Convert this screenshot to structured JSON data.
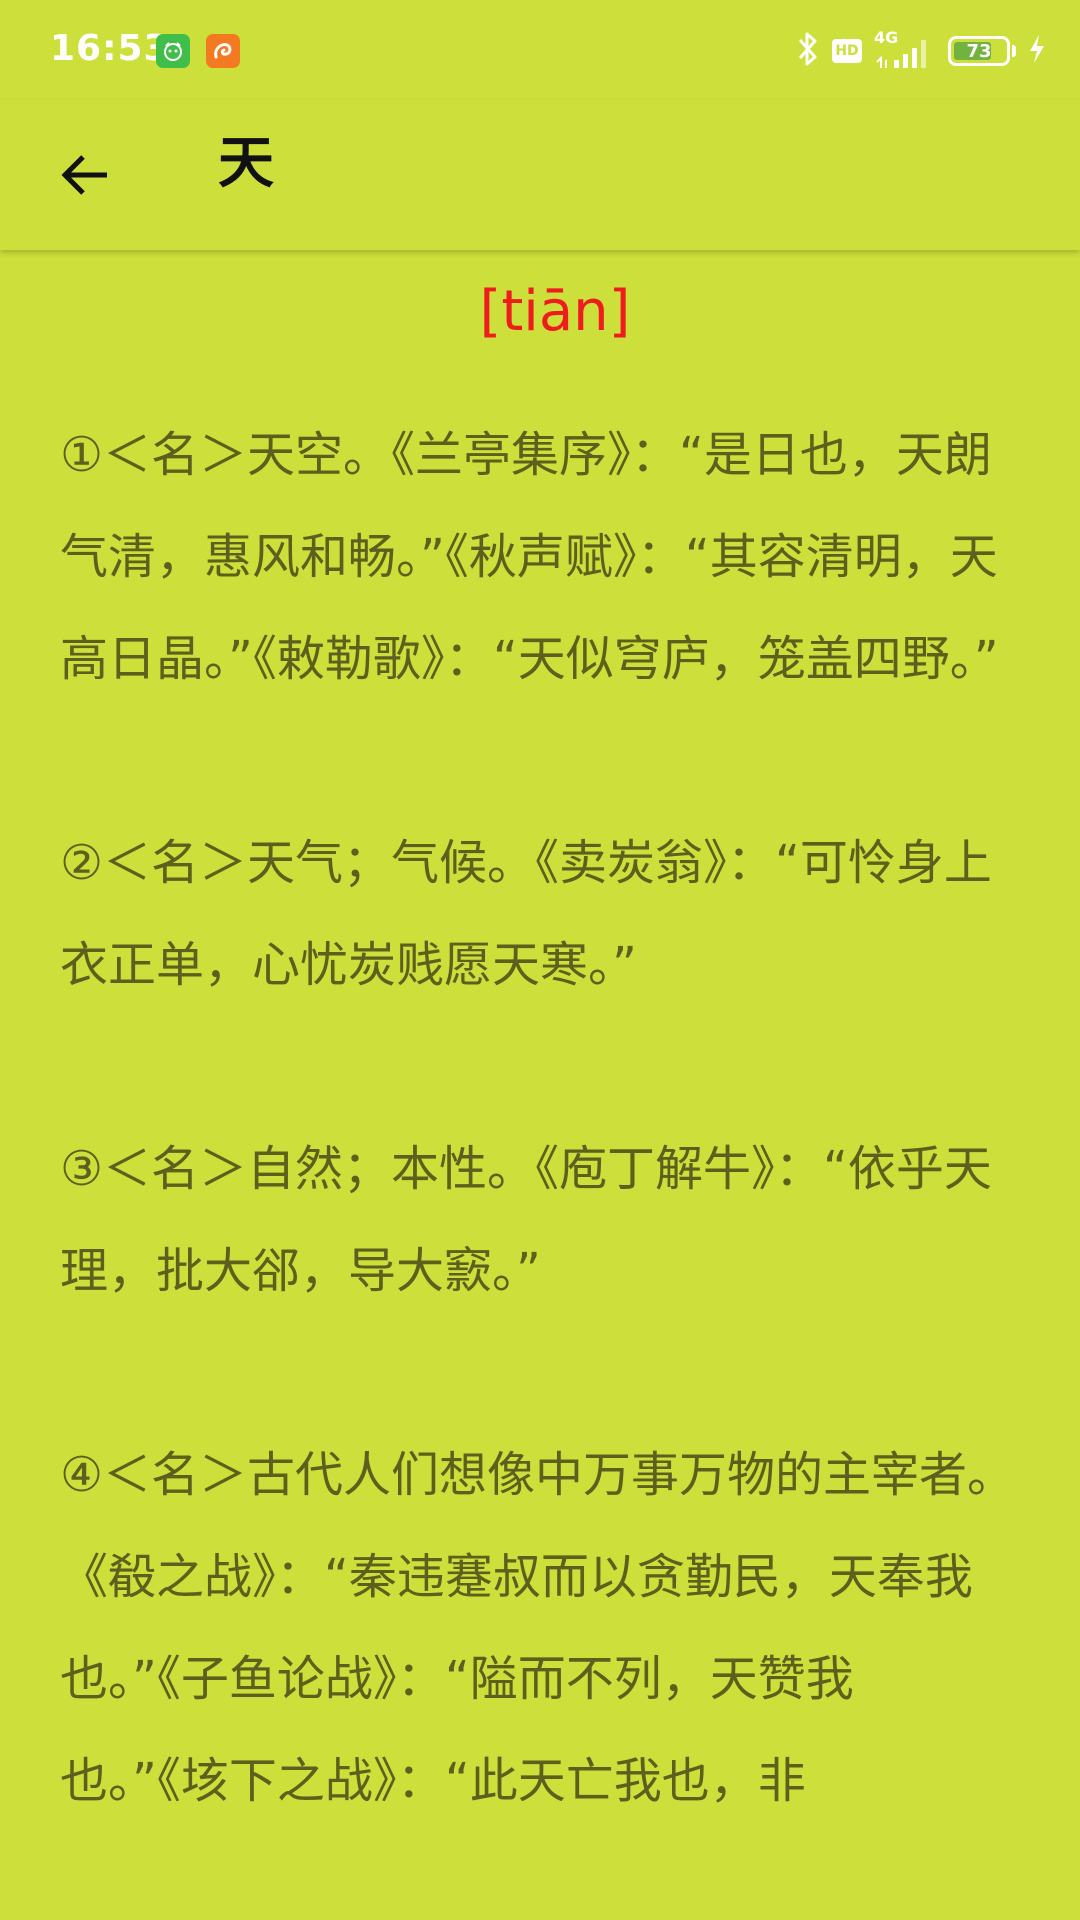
{
  "status_bar": {
    "time": "16:53",
    "network": "4G",
    "hd": "HD",
    "battery_level": "73",
    "battery_fraction": 0.73
  },
  "app_bar": {
    "title": "天"
  },
  "entry": {
    "pinyin": "[tiān]",
    "definitions": [
      "①＜名＞天空。《兰亭集序》：“是日也，天朗气清，惠风和畅。”《秋声赋》：“其容清明，天高日晶。”《敕勒歌》：“天似穹庐，笼盖四野。”",
      "②＜名＞天气；气候。《卖炭翁》：“可怜身上衣正单，心忧炭贱愿天寒。”",
      "③＜名＞自然；本性。《庖丁解牛》：“依乎天理，批大郤，导大窾。”",
      "④＜名＞古代人们想像中万事万物的主宰者。《殽之战》：“秦违蹇叔而以贪勤民，天奉我也。”《子鱼论战》：“隘而不列，天赞我也。”《垓下之战》：“此天亡我也，非"
    ]
  },
  "colors": {
    "background": "#cddf3b",
    "pinyin": "#ee1c1c",
    "text": "#5d5f1d",
    "title": "#111111"
  },
  "icons": {
    "back": "arrow-left-icon",
    "bluetooth": "bluetooth-icon",
    "signal": "signal-bars-icon",
    "charging": "lightning-icon",
    "notification_1": "green-app-notification-icon",
    "notification_2": "orange-app-notification-icon"
  }
}
